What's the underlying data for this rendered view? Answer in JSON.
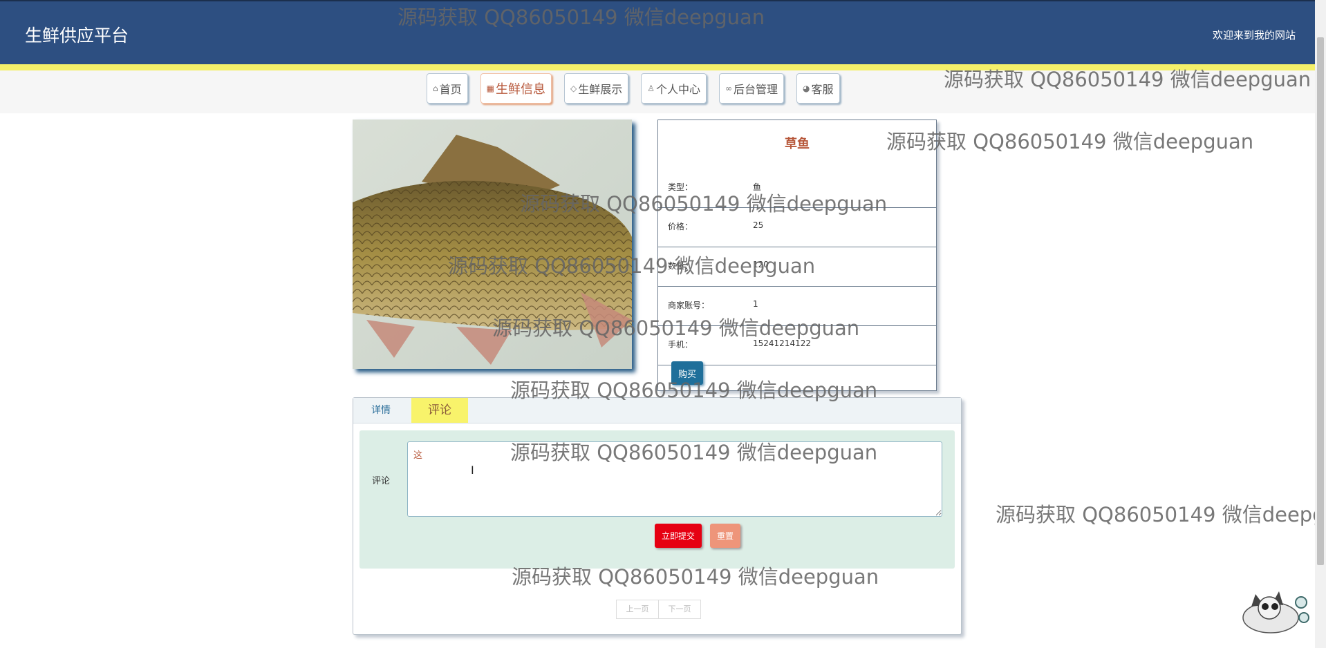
{
  "header": {
    "site_title": "生鲜供应平台",
    "welcome": "欢迎来到我的网站"
  },
  "nav": {
    "items": [
      {
        "label": "首页",
        "icon": "home-icon",
        "glyph": "⌂"
      },
      {
        "label": "生鲜信息",
        "icon": "calendar-icon",
        "glyph": "▦",
        "active": true
      },
      {
        "label": "生鲜展示",
        "icon": "tag-icon",
        "glyph": "◇"
      },
      {
        "label": "个人中心",
        "icon": "user-icon",
        "glyph": "♙"
      },
      {
        "label": "后台管理",
        "icon": "link-icon",
        "glyph": "∞"
      },
      {
        "label": "客服",
        "icon": "chat-icon",
        "glyph": "◕"
      }
    ]
  },
  "product": {
    "name": "草鱼",
    "fields": [
      {
        "label": "类型：",
        "value": "鱼"
      },
      {
        "label": "价格：",
        "value": "25"
      },
      {
        "label": "数量：",
        "value": "120"
      },
      {
        "label": "商家账号：",
        "value": "1"
      },
      {
        "label": "手机：",
        "value": "15241214122"
      }
    ],
    "buy_label": "购买"
  },
  "tabs": {
    "items": [
      {
        "label": "详情"
      },
      {
        "label": "评论",
        "active": true
      }
    ],
    "comment_label": "评论",
    "comment_value": "这",
    "submit_label": "立即提交",
    "reset_label": "重置",
    "prev_label": "上一页",
    "next_label": "下一页"
  },
  "watermark": "源码获取 QQ86050149 微信deepguan",
  "colors": {
    "header": "#2d4f81",
    "accent": "#b7583b",
    "tab_active": "#f8f36b",
    "submit": "#e60012"
  }
}
